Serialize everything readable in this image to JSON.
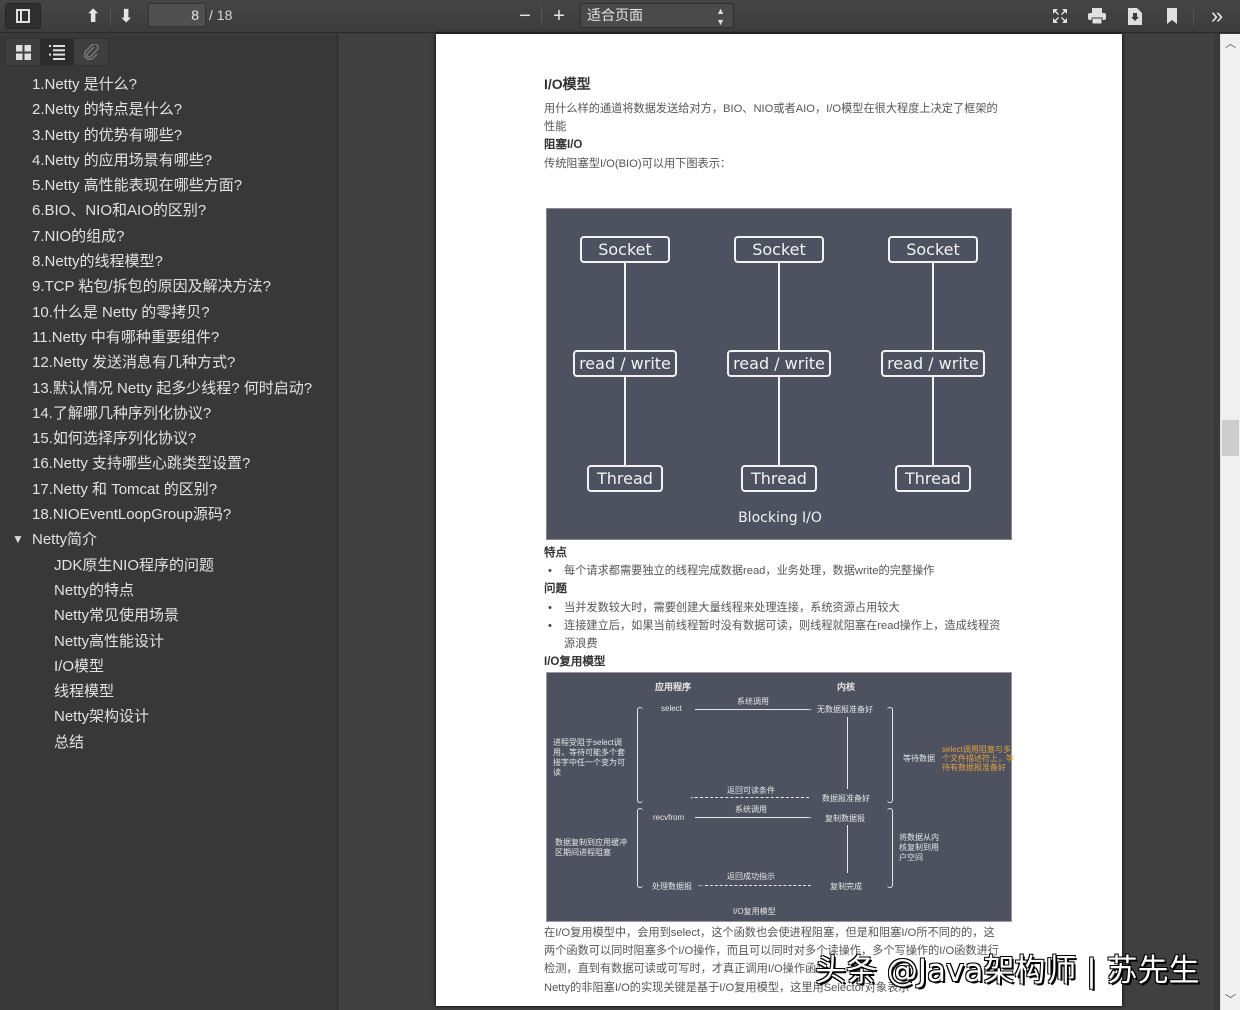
{
  "toolbar": {
    "current_page": "8",
    "total_pages": "/ 18",
    "zoom_minus": "−",
    "zoom_plus": "+",
    "zoom_value": "适合页面",
    "icons": {
      "sidebar_toggle": "sidebar-toggle-icon",
      "prev_page": "⬆",
      "next_page": "⬇",
      "fullscreen": "⛶",
      "print": "🖶",
      "download": "⬇",
      "bookmark": "🔖",
      "more": "»"
    }
  },
  "sidebar": {
    "tabs": [
      {
        "name": "thumbnails",
        "glyph": "▦"
      },
      {
        "name": "outline",
        "glyph": "☰"
      },
      {
        "name": "attachments",
        "glyph": "📎"
      }
    ],
    "outline": [
      {
        "label": "1.Netty 是什么?",
        "level": 1
      },
      {
        "label": "2.Netty 的特点是什么?",
        "level": 1
      },
      {
        "label": "3.Netty 的优势有哪些?",
        "level": 1
      },
      {
        "label": "4.Netty 的应用场景有哪些?",
        "level": 1
      },
      {
        "label": "5.Netty 高性能表现在哪些方面?",
        "level": 1
      },
      {
        "label": "6.BIO、NIO和AIO的区别?",
        "level": 1
      },
      {
        "label": "7.NIO的组成?",
        "level": 1
      },
      {
        "label": "8.Netty的线程模型?",
        "level": 1
      },
      {
        "label": "9.TCP 粘包/拆包的原因及解决方法?",
        "level": 1
      },
      {
        "label": "10.什么是 Netty 的零拷贝?",
        "level": 1
      },
      {
        "label": "11.Netty 中有哪种重要组件?",
        "level": 1
      },
      {
        "label": "12.Netty 发送消息有几种方式?",
        "level": 1
      },
      {
        "label": "13.默认情况 Netty 起多少线程? 何时启动?",
        "level": 1
      },
      {
        "label": "14.了解哪几种序列化协议?",
        "level": 1
      },
      {
        "label": "15.如何选择序列化协议?",
        "level": 1
      },
      {
        "label": "16.Netty 支持哪些心跳类型设置?",
        "level": 1
      },
      {
        "label": "17.Netty 和 Tomcat 的区别?",
        "level": 1
      },
      {
        "label": "18.NIOEventLoopGroup源码?",
        "level": 1
      },
      {
        "label": "Netty简介",
        "level": 1,
        "expanded": true,
        "twisty": "▼"
      },
      {
        "label": "JDK原生NIO程序的问题",
        "level": 2
      },
      {
        "label": "Netty的特点",
        "level": 2
      },
      {
        "label": "Netty常见使用场景",
        "level": 2
      },
      {
        "label": "Netty高性能设计",
        "level": 2
      },
      {
        "label": "I/O模型",
        "level": 2
      },
      {
        "label": "线程模型",
        "level": 2
      },
      {
        "label": "Netty架构设计",
        "level": 2
      },
      {
        "label": "总结",
        "level": 2
      }
    ]
  },
  "document": {
    "title": "I/O模型",
    "intro_line1": "用什么样的通道将数据发送给对方，BIO、NIO或者AIO，I/O模型在很大程度上决定了框架的",
    "intro_line2": "性能",
    "blocking_heading": "阻塞I/O",
    "blocking_desc": "传统阻塞型I/O(BIO)可以用下图表示：",
    "diagram1": {
      "socket_label": "Socket",
      "rw_label": "read / write",
      "thread_label": "Thread",
      "caption": "Blocking I/O"
    },
    "features_heading": "特点",
    "features": [
      "每个请求都需要独立的线程完成数据read，业务处理，数据write的完整操作"
    ],
    "problems_heading": "问题",
    "problems": [
      "当并发数较大时，需要创建大量线程来处理连接，系统资源占用较大",
      "连接建立后，如果当前线程暂时没有数据可读，则线程就阻塞在read操作上，造成线程资",
      "源浪费"
    ],
    "multiplex_heading": "I/O复用模型",
    "diagram2": {
      "col_app": "应用程序",
      "col_kernel": "内核",
      "select": "select",
      "syscall1": "系统调用",
      "no_data": "无数据报准备好",
      "left_note1": "进程受阻于select调用，等待可能多个套接字中任一个变为可读",
      "wait_data": "等待数据",
      "orange_note": "select调用阻塞与多个文件描述符上，等待有数据报准备好",
      "return_readable": "返回可读条件",
      "data_ready": "数据报准备好",
      "recvfrom": "recvfrom",
      "syscall2": "系统调用",
      "copy_data": "复制数据报",
      "left_note2": "数据复制到应用缓冲区期间进程阻塞",
      "right_note2": "将数据从内核复制到用户空间",
      "return_ok": "返回成功指示",
      "process_data": "处理数据报",
      "copy_done": "复制完成",
      "caption": "I/O复用模型"
    },
    "para1_line1": "在I/O复用模型中，会用到select，这个函数也会使进程阻塞，但是和阻塞I/O所不同的的，这",
    "para1_line2": "两个函数可以同时阻塞多个I/O操作，而且可以同时对多个读操作，多个写操作的I/O函数进行",
    "para1_line3": "检测，直到有数据可读或可写时，才真正调用I/O操作函数",
    "para2_line1": "Netty的非阻塞I/O的实现关键是基于I/O复用模型，这里用Selector对象表示"
  },
  "watermark": "头条 @Java架构师 | 苏先生",
  "scrollbar": {
    "up": "︿",
    "down": "﹀",
    "position_fraction": 0.41
  }
}
